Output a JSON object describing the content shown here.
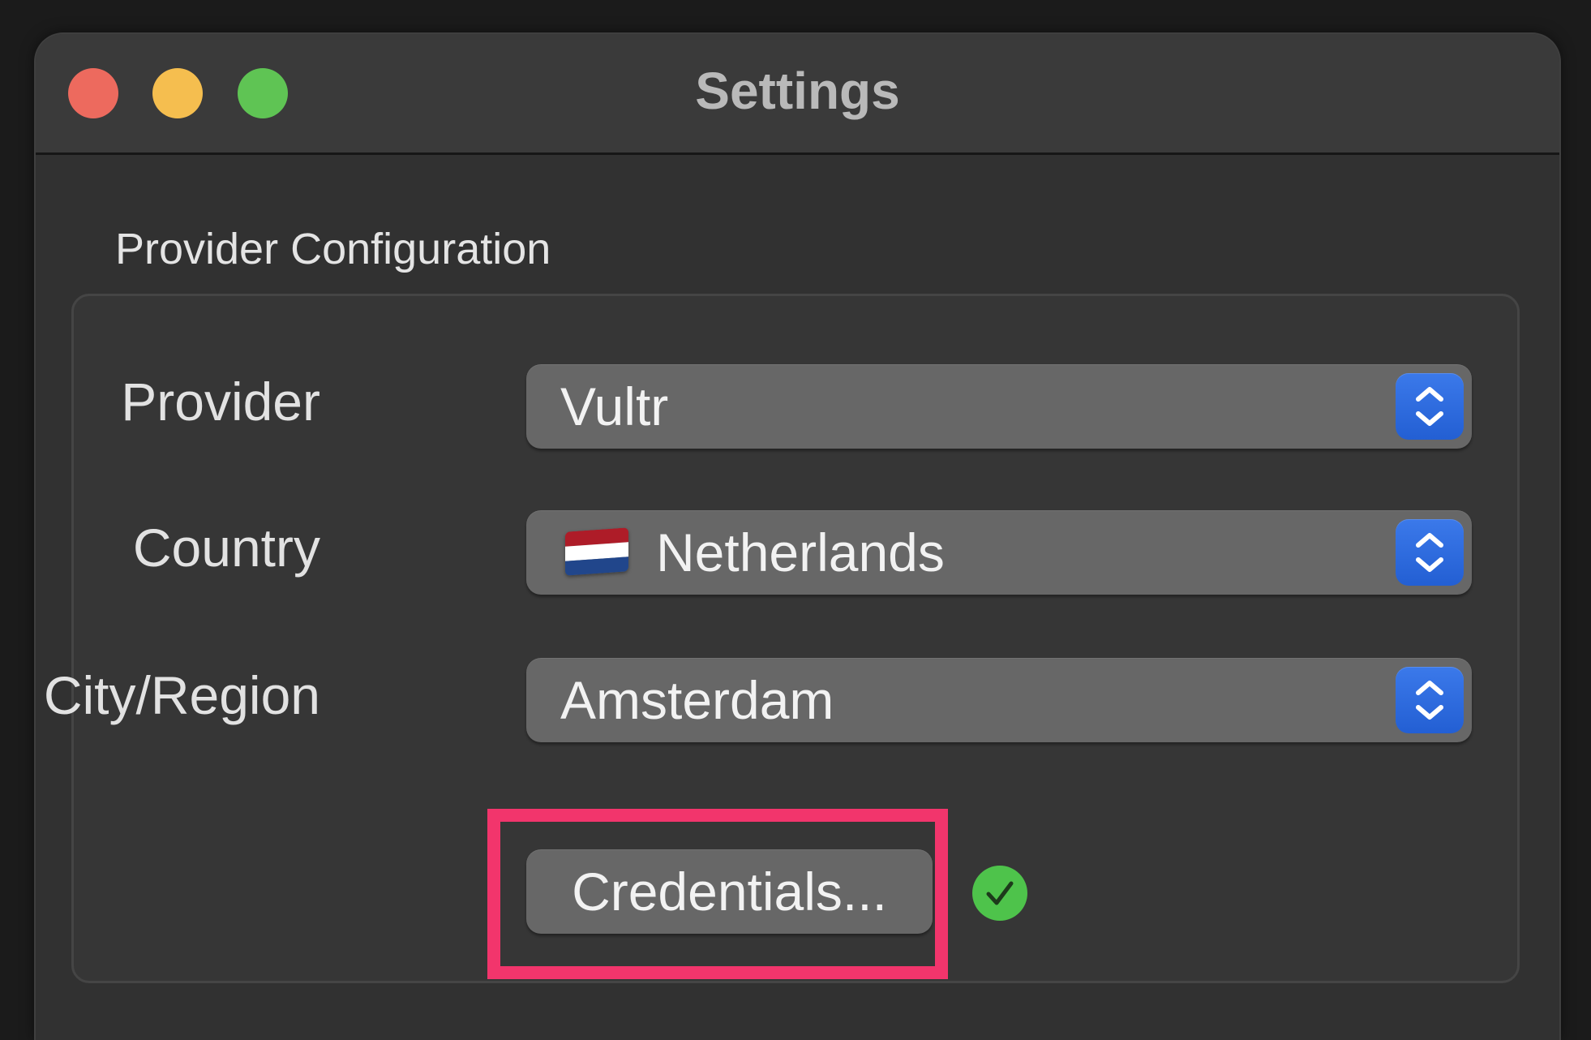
{
  "window": {
    "title": "Settings"
  },
  "section": {
    "title": "Provider Configuration"
  },
  "fields": {
    "provider": {
      "label": "Provider",
      "value": "Vultr"
    },
    "country": {
      "label": "Country",
      "value": "Netherlands",
      "flag_icon": "netherlands-flag-icon",
      "flag_colors": [
        "#ae1c28",
        "#ffffff",
        "#21468b"
      ]
    },
    "city_region": {
      "label": "City/Region",
      "value": "Amsterdam"
    }
  },
  "credentials": {
    "button_label": "Credentials...",
    "status_icon": "checkmark-icon",
    "status_color": "#4ec34b"
  },
  "colors": {
    "accent": "#2f6fe4",
    "highlight": "#f2356c",
    "close": "#ed6a5e",
    "minimize": "#f5be4f",
    "zoom": "#5fc454"
  }
}
